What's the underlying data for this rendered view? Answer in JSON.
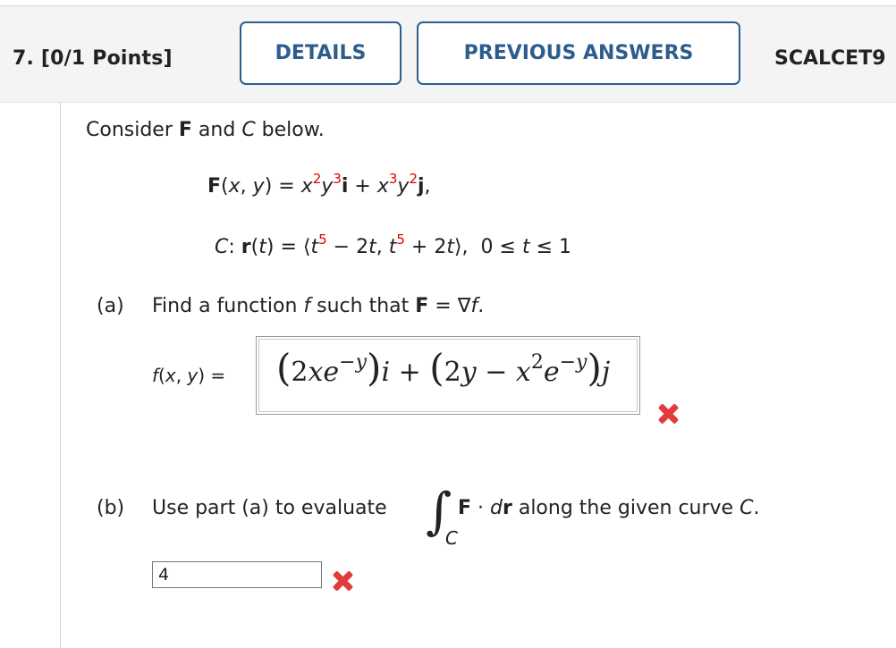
{
  "header": {
    "question_label": "7. [0/1 Points]",
    "details_button": "DETAILS",
    "previous_answers_button": "PREVIOUS ANSWERS",
    "reference": "SCALCET9"
  },
  "problem": {
    "intro": "Consider F and C below.",
    "part_a_label": "(a)",
    "part_a_text": "Find a function f such that F = ∇f.",
    "f_label": "f(x, y) =",
    "part_a_answer": "(2xe−y)i + (2y − x2e−y)j",
    "part_b_label": "(b)",
    "part_b_text_before": "Use part (a) to evaluate",
    "part_b_text_after": "F · dr along the given curve C.",
    "part_b_answer": "4"
  },
  "status": {
    "part_a": "incorrect",
    "part_b": "incorrect",
    "incorrect_color": "#e03c3c"
  }
}
